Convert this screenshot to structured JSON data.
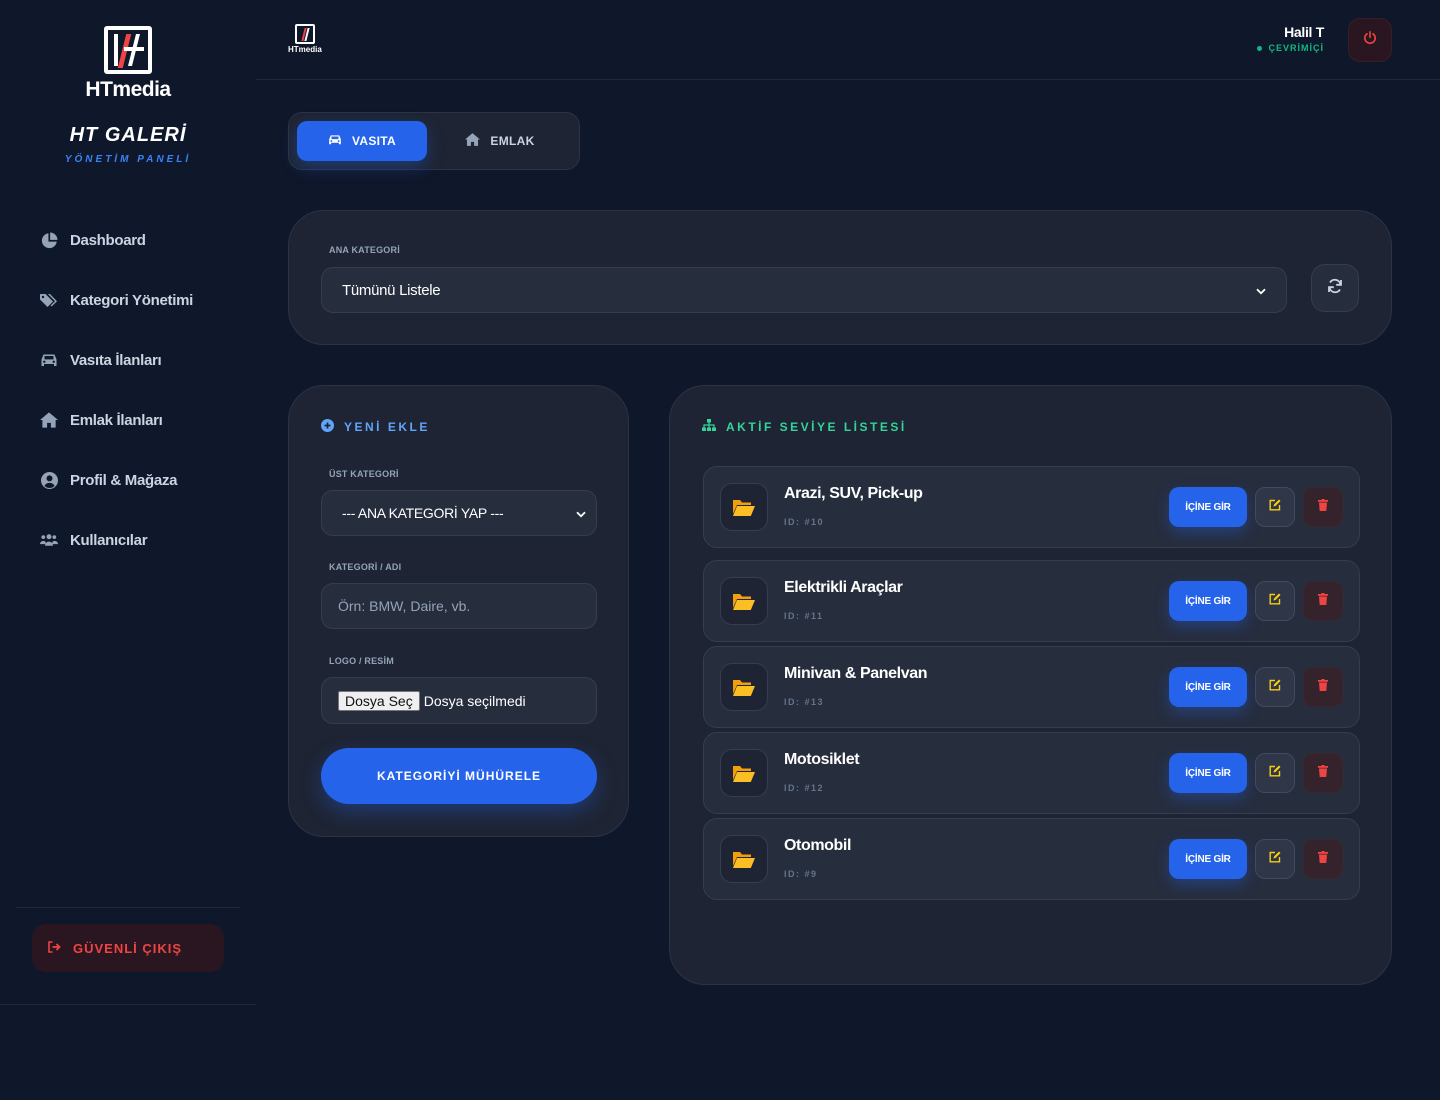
{
  "brand": {
    "name": "HTmedia",
    "title": "HT GALERİ",
    "subtitle": "YÖNETİM PANELİ"
  },
  "sidebar": {
    "items": [
      {
        "label": "Dashboard",
        "icon": "chart-pie-icon"
      },
      {
        "label": "Kategori Yönetimi",
        "icon": "tags-icon"
      },
      {
        "label": "Vasıta İlanları",
        "icon": "car-icon"
      },
      {
        "label": "Emlak İlanları",
        "icon": "home-icon"
      },
      {
        "label": "Profil & Mağaza",
        "icon": "user-circle-icon"
      },
      {
        "label": "Kullanıcılar",
        "icon": "users-icon"
      }
    ],
    "logout_label": "GÜVENLİ ÇIKIŞ"
  },
  "topbar": {
    "logo_text": "HTmedia",
    "user_name": "Halil T",
    "user_status": "ÇEVRİMİÇİ"
  },
  "tabs": [
    {
      "label": "VASITA",
      "active": true
    },
    {
      "label": "EMLAK",
      "active": false
    }
  ],
  "filter": {
    "label": "ANA KATEGORİ",
    "selected": "Tümünü Listele"
  },
  "add_form": {
    "title": "YENİ EKLE",
    "parent_label": "ÜST KATEGORİ",
    "parent_selected": "--- ANA KATEGORİ YAP ---",
    "name_label": "KATEGORİ / ADI",
    "name_placeholder": "Örn: BMW, Daire, vb.",
    "logo_label": "LOGO / RESİM",
    "file_button": "Dosya Seç",
    "file_status": "Dosya seçilmedi",
    "submit_label": "KATEGORİYİ MÜHÜRELE"
  },
  "list": {
    "title": "AKTİF SEVİYE LİSTESİ",
    "enter_label": "İÇİNE GİR",
    "rows": [
      {
        "name": "Arazi, SUV, Pick-up",
        "id": "ID: #10"
      },
      {
        "name": "Elektrikli Araçlar",
        "id": "ID: #11"
      },
      {
        "name": "Minivan & Panelvan",
        "id": "ID: #13"
      },
      {
        "name": "Motosiklet",
        "id": "ID: #12"
      },
      {
        "name": "Otomobil",
        "id": "ID: #9"
      }
    ]
  },
  "colors": {
    "accent": "#2563eb",
    "danger": "#ef4444",
    "success": "#10b981",
    "warning": "#f59e0b",
    "bg": "#0f172a",
    "panel": "#1e2433"
  }
}
